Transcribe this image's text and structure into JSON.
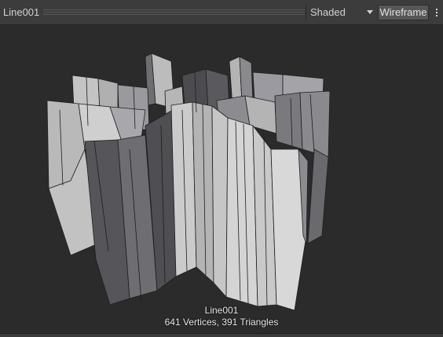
{
  "toolbar": {
    "object_name": "Line001",
    "shading_mode": "Shaded",
    "wireframe_label": "Wireframe"
  },
  "icons": {
    "dropdown_caret": "chevron-down-icon",
    "menu": "more-vertical-icon"
  },
  "preview": {
    "mesh_name": "Line001",
    "stats": "641 Vertices, 391 Triangles"
  },
  "colors": {
    "toolbar_bg": "#3c3c3c",
    "viewport_bg": "#2b2b2b",
    "wireframe_button_bg": "#575757"
  }
}
